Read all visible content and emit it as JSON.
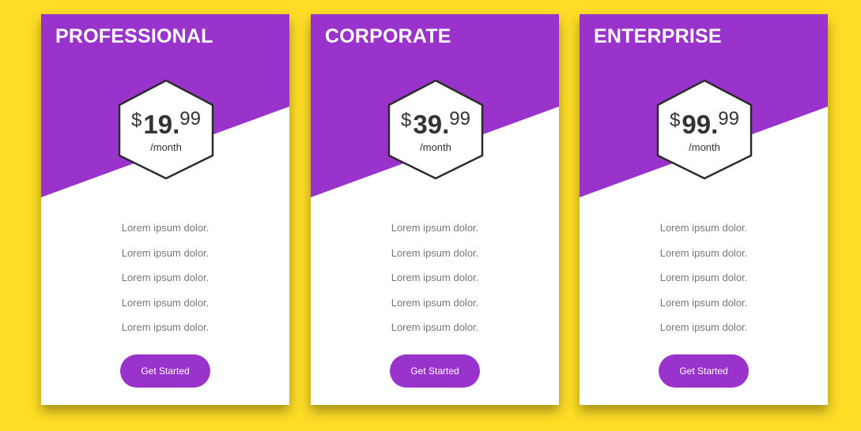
{
  "colors": {
    "page_background": "#fddd26",
    "accent": "#9933cc",
    "card_background": "#ffffff",
    "feature_text": "#777777",
    "price_text": "#333333"
  },
  "plans": [
    {
      "name": "PROFESSIONAL",
      "currency": "$",
      "amount": "19.",
      "cents": "99",
      "period": "/month",
      "features": [
        "Lorem ipsum dolor.",
        "Lorem ipsum dolor.",
        "Lorem ipsum dolor.",
        "Lorem ipsum dolor.",
        "Lorem ipsum dolor."
      ],
      "button_label": "Get Started"
    },
    {
      "name": "CORPORATE",
      "currency": "$",
      "amount": "39.",
      "cents": "99",
      "period": "/month",
      "features": [
        "Lorem ipsum dolor.",
        "Lorem ipsum dolor.",
        "Lorem ipsum dolor.",
        "Lorem ipsum dolor.",
        "Lorem ipsum dolor."
      ],
      "button_label": "Get Started"
    },
    {
      "name": "ENTERPRISE",
      "currency": "$",
      "amount": "99.",
      "cents": "99",
      "period": "/month",
      "features": [
        "Lorem ipsum dolor.",
        "Lorem ipsum dolor.",
        "Lorem ipsum dolor.",
        "Lorem ipsum dolor.",
        "Lorem ipsum dolor."
      ],
      "button_label": "Get Started"
    }
  ]
}
